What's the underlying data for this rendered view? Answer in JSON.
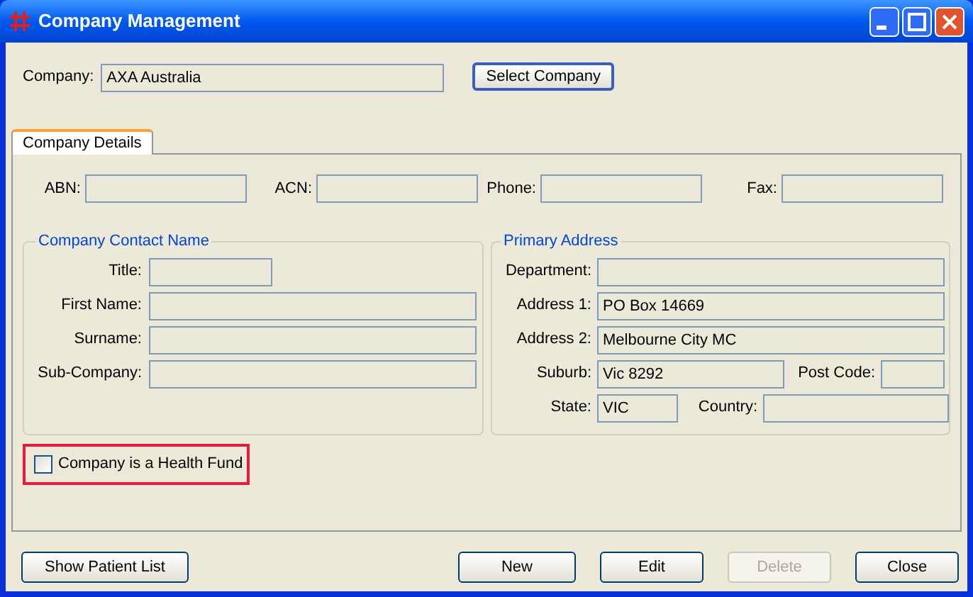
{
  "window": {
    "title": "Company Management"
  },
  "company": {
    "label": "Company:",
    "value": "AXA Australia"
  },
  "select_button": {
    "label": "Select Company"
  },
  "tabs": [
    {
      "label": "Company Details",
      "selected": true
    }
  ],
  "details": [
    {
      "label": "ABN:"
    },
    {
      "label": "ACN:"
    },
    {
      "label": "Phone:"
    },
    {
      "label": "Fax:"
    }
  ],
  "contact_group": {
    "title": "Company Contact Name",
    "fields": [
      {
        "label": "Title:"
      },
      {
        "label": "First Name:"
      },
      {
        "label": "Surname:"
      },
      {
        "label": "Sub-Company:"
      }
    ]
  },
  "address_group": {
    "title": "Primary Address",
    "rows": [
      [
        {
          "label": "Department:"
        }
      ],
      [
        {
          "label": "Address 1:",
          "value": "PO Box 14669"
        }
      ],
      [
        {
          "label": "Address 2:",
          "value": "Melbourne City MC"
        }
      ],
      [
        {
          "label": "Suburb:",
          "value": "Vic 8292"
        },
        {
          "label": "Post Code:"
        }
      ],
      [
        {
          "label": "State:",
          "value": "VIC"
        },
        {
          "label": "Country:"
        }
      ]
    ]
  },
  "health_fund": {
    "label": "Company is a Health Fund",
    "checked": false,
    "highlighted": true
  },
  "buttons": [
    {
      "label": "Show Patient List",
      "disabled": false
    },
    {
      "label": "New",
      "disabled": false
    },
    {
      "label": "Edit",
      "disabled": false
    },
    {
      "label": "Delete",
      "disabled": true
    },
    {
      "label": "Close",
      "disabled": false
    }
  ]
}
